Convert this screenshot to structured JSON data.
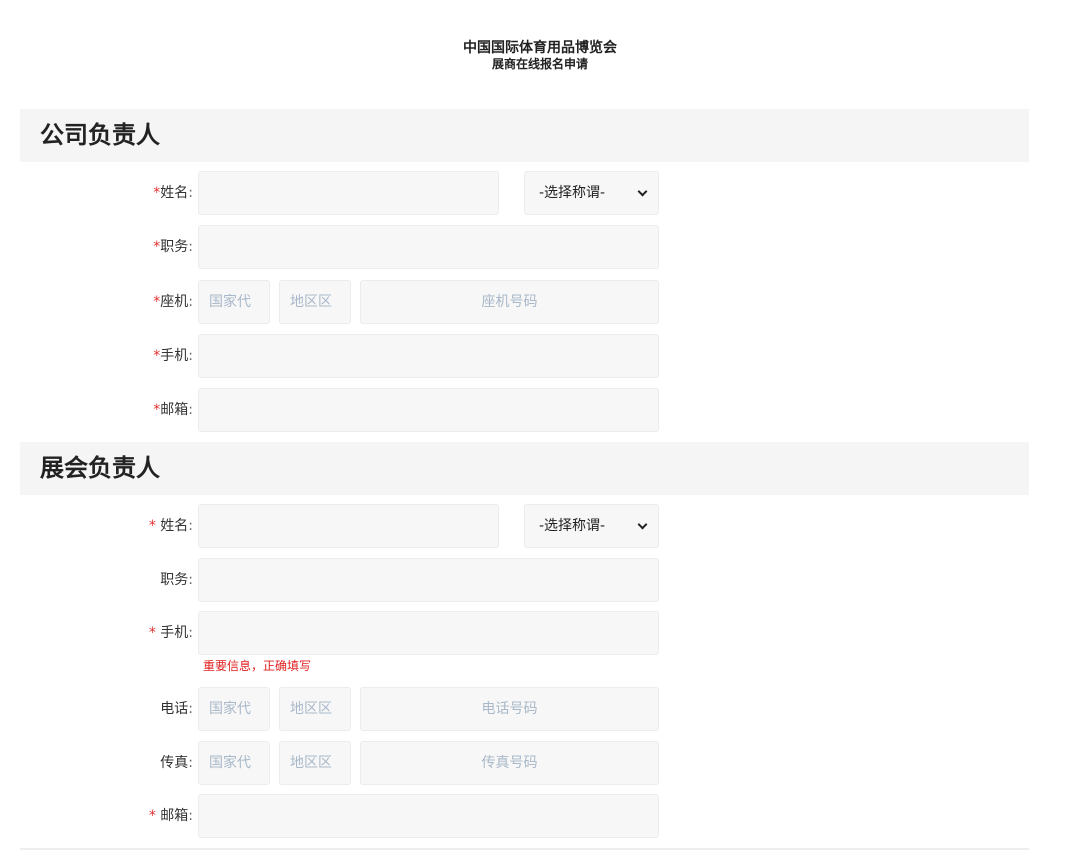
{
  "header": {
    "title": "中国国际体育用品博览会",
    "subtitle": "展商在线报名申请"
  },
  "company_section": {
    "title": "公司负责人",
    "name_label": "姓名",
    "title_select": "-选择称谓-",
    "position_label": "职务",
    "landline_label": "座机",
    "landline_country_placeholder": "国家代",
    "landline_area_placeholder": "地区区",
    "landline_number_placeholder": "座机号码",
    "mobile_label": "手机",
    "email_label": "邮箱"
  },
  "exhibition_section": {
    "title": "展会负责人",
    "name_label": "姓名",
    "title_select": "-选择称谓-",
    "position_label": "职务",
    "mobile_label": "手机",
    "mobile_hint": "重要信息，正确填写",
    "phone_label": "电话",
    "phone_country_placeholder": "国家代",
    "phone_area_placeholder": "地区区",
    "phone_number_placeholder": "电话号码",
    "fax_label": "传真",
    "fax_country_placeholder": "国家代",
    "fax_area_placeholder": "地区区",
    "fax_number_placeholder": "传真号码",
    "email_label": "邮箱"
  },
  "labels": {
    "required_mark": "*",
    "colon": ":"
  },
  "colors": {
    "required": "#e03030",
    "hint": "#e02020",
    "placeholder": "#a9b8c9",
    "section_bg": "#f5f5f5",
    "field_bg": "#f7f7f7"
  },
  "icons": {
    "select_arrow": "chevron-down-icon"
  }
}
